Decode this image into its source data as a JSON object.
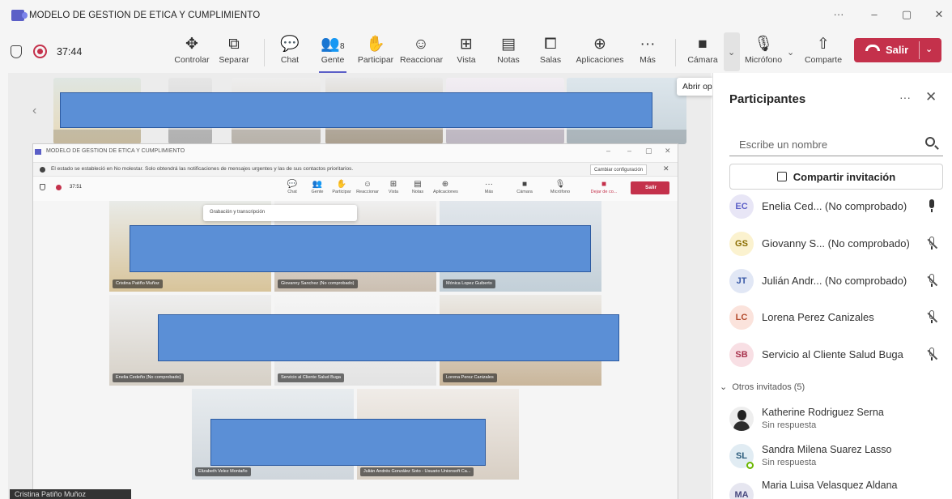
{
  "window": {
    "title": "MODELO DE GESTION DE ETICA Y CUMPLIMIENTO",
    "minimize": "–",
    "maximize": "▢",
    "close": "✕",
    "more": "···"
  },
  "meeting": {
    "timer": "37:44"
  },
  "toolbar": {
    "items": [
      {
        "label": "Controlar",
        "icon": "✥"
      },
      {
        "label": "Separar",
        "icon": "⧉"
      },
      {
        "label": "Chat",
        "icon": "💬"
      },
      {
        "label": "Gente",
        "icon": "👥",
        "count": "8"
      },
      {
        "label": "Participar",
        "icon": "✋"
      },
      {
        "label": "Reaccionar",
        "icon": "☺"
      },
      {
        "label": "Vista",
        "icon": "⊞"
      },
      {
        "label": "Notas",
        "icon": "▤"
      },
      {
        "label": "Salas",
        "icon": "⧠"
      },
      {
        "label": "Aplicaciones",
        "icon": "⊕"
      },
      {
        "label": "Más",
        "icon": "···"
      },
      {
        "label": "Cámara",
        "icon": "■"
      },
      {
        "label": "Micrófono",
        "icon": "🎙"
      },
      {
        "label": "Comparte",
        "icon": "⇧"
      }
    ],
    "leave_label": "Salir"
  },
  "tooltip": "Abrir opciones de vídeo",
  "inner_window": {
    "title": "MODELO DE GESTION DE ETICA Y CUMPLIMIENTO",
    "notice": "El estado se estableció en No molestar. Solo obtendrá las notificaciones de mensajes urgentes y las de sus contactos prioritarios.",
    "config_button": "Cambiar configuración",
    "timer": "37:51",
    "toolbar": [
      "Chat",
      "Gente",
      "Participar",
      "Reaccionar",
      "Vista",
      "Notas",
      "Aplicaciones",
      "Más",
      "Cámara",
      "Micrófono",
      "Dejar de co..."
    ],
    "leave_label": "Salir",
    "popup": "Grabación y transcripción",
    "tiles": [
      {
        "name": "Cristina Patiño Muñoz"
      },
      {
        "name": "Giovanny Sanchez (No comprobado)"
      },
      {
        "name": "Mónica Lopez Guiberto"
      },
      {
        "name": "Enelia Cedeño (No comprobado)"
      },
      {
        "name": "Servicio al Cliente Salud Buga"
      },
      {
        "name": "Lorena Perez Canizales"
      },
      {
        "name": "Elizabeth Velez Montaño"
      },
      {
        "name": "Julián Andrés González Soto - Usuario Unionsoft Ca..."
      }
    ]
  },
  "speaker_tag": "Cristina Patiño Muñoz",
  "panel": {
    "title": "Participantes",
    "search_placeholder": "Escribe un nombre",
    "invite_label": "Compartir invitación",
    "participants": [
      {
        "initials": "EC",
        "name": "Enelia Ced...  (No comprobado)",
        "muted": false,
        "color": "#e8e6f6",
        "fg": "#5b5fc7"
      },
      {
        "initials": "GS",
        "name": "Giovanny S...  (No comprobado)",
        "muted": true,
        "color": "#fbf2cf",
        "fg": "#8a6d00"
      },
      {
        "initials": "JT",
        "name": "Julián Andr...  (No comprobado)",
        "muted": true,
        "color": "#e1e7f5",
        "fg": "#3a5aa8"
      },
      {
        "initials": "LC",
        "name": "Lorena Perez Canizales",
        "muted": true,
        "color": "#fbe3dc",
        "fg": "#b34a2c"
      },
      {
        "initials": "SB",
        "name": "Servicio al Cliente Salud Buga",
        "muted": true,
        "color": "#f8dfe4",
        "fg": "#a8324d"
      }
    ],
    "others_label": "Otros invitados (5)",
    "guests": [
      {
        "initials": "",
        "name": "Katherine Rodriguez Serna",
        "status": "Sin respuesta"
      },
      {
        "initials": "SL",
        "name": "Sandra Milena Suarez Lasso",
        "status": "Sin respuesta"
      },
      {
        "initials": "MA",
        "name": "Maria Luisa Velasquez Aldana",
        "status": ""
      }
    ]
  }
}
